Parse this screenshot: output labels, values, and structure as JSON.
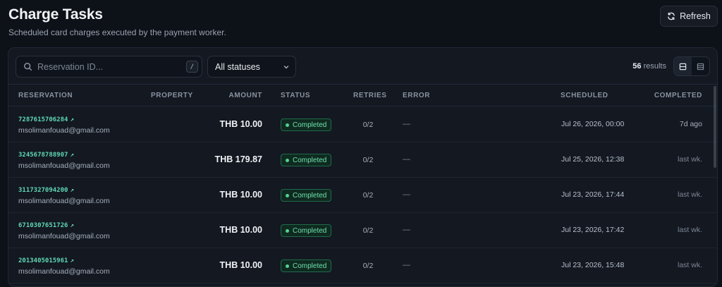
{
  "header": {
    "title": "Charge Tasks",
    "subtitle": "Scheduled card charges executed by the payment worker.",
    "refresh_label": "Refresh"
  },
  "toolbar": {
    "search_placeholder": "Reservation ID...",
    "search_shortcut": "/",
    "status_filter": "All statuses",
    "results_count": "56",
    "results_label": "results"
  },
  "columns": {
    "reservation": "RESERVATION",
    "property": "PROPERTY",
    "amount": "AMOUNT",
    "status": "STATUS",
    "retries": "RETRIES",
    "error": "ERROR",
    "scheduled": "SCHEDULED",
    "completed": "COMPLETED"
  },
  "rows": [
    {
      "id": "7287615706284",
      "email": "msolimanfouad@gmail.com",
      "amount": "THB 10.00",
      "status": "Completed",
      "retries": "0/2",
      "error": "—",
      "scheduled": "Jul 26, 2026, 00:00",
      "completed": "7d ago"
    },
    {
      "id": "3245678788907",
      "email": "msolimanfouad@gmail.com",
      "amount": "THB 179.87",
      "status": "Completed",
      "retries": "0/2",
      "error": "—",
      "scheduled": "Jul 25, 2026, 12:38",
      "completed": "last wk."
    },
    {
      "id": "3117327094200",
      "email": "msolimanfouad@gmail.com",
      "amount": "THB 10.00",
      "status": "Completed",
      "retries": "0/2",
      "error": "—",
      "scheduled": "Jul 23, 2026, 17:44",
      "completed": "last wk."
    },
    {
      "id": "6710307651726",
      "email": "msolimanfouad@gmail.com",
      "amount": "THB 10.00",
      "status": "Completed",
      "retries": "0/2",
      "error": "—",
      "scheduled": "Jul 23, 2026, 17:42",
      "completed": "last wk."
    },
    {
      "id": "2013405015961",
      "email": "msolimanfouad@gmail.com",
      "amount": "THB 10.00",
      "status": "Completed",
      "retries": "0/2",
      "error": "—",
      "scheduled": "Jul 23, 2026, 15:48",
      "completed": "last wk."
    }
  ],
  "colors": {
    "accent": "#5fd6b4",
    "status_completed": "#4fd392",
    "background": "#0d1118",
    "card": "#131821"
  },
  "icons": {
    "refresh": "refresh-icon",
    "search": "search-icon",
    "status_chevron": "chevron-down-icon",
    "external_link": "external-link-icon",
    "view_comfortable": "rows-icon",
    "view_compact": "compact-rows-icon"
  }
}
